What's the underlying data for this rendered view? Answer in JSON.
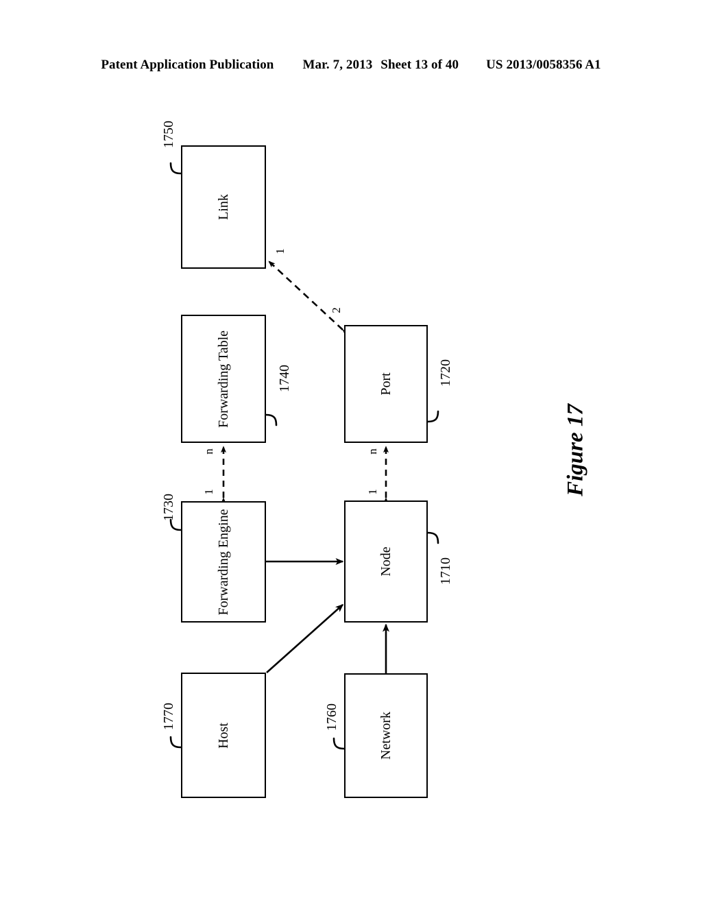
{
  "header": {
    "publication": "Patent Application Publication",
    "date": "Mar. 7, 2013",
    "sheet": "Sheet 13 of 40",
    "patent_number": "US 2013/0058356 A1"
  },
  "figure": {
    "caption": "Figure 17",
    "orientation": "landscape-rotated-90",
    "type": "uml-class-diagram"
  },
  "boxes": [
    {
      "id": "link",
      "label": "Link",
      "ref": "1750"
    },
    {
      "id": "forwarding_table",
      "label": "Forwarding Table",
      "ref": "1740"
    },
    {
      "id": "port",
      "label": "Port",
      "ref": "1720"
    },
    {
      "id": "forwarding_engine",
      "label": "Forwarding Engine",
      "ref": "1730"
    },
    {
      "id": "node",
      "label": "Node",
      "ref": "1710"
    },
    {
      "id": "host",
      "label": "Host",
      "ref": "1770"
    },
    {
      "id": "network",
      "label": "Network",
      "ref": "1760"
    }
  ],
  "multiplicities": {
    "link_end": "1",
    "port_end": "2",
    "forwarding_table_end": "n",
    "forwarding_engine_end": "1",
    "port_node_port_end": "n",
    "port_node_node_end": "1"
  },
  "connectors": [
    {
      "from": "port",
      "to": "link",
      "style": "dashed",
      "arrows": "both",
      "from_mult": "2",
      "to_mult": "1"
    },
    {
      "from": "forwarding_engine",
      "to": "forwarding_table",
      "style": "dashed",
      "arrows": "both",
      "from_mult": "1",
      "to_mult": "n"
    },
    {
      "from": "node",
      "to": "port",
      "style": "dashed",
      "arrows": "both",
      "from_mult": "1",
      "to_mult": "n"
    },
    {
      "from": "forwarding_engine",
      "to": "node",
      "style": "solid",
      "arrows": "end"
    },
    {
      "from": "host",
      "to": "node",
      "style": "solid",
      "arrows": "end"
    },
    {
      "from": "network",
      "to": "node",
      "style": "solid",
      "arrows": "end"
    }
  ],
  "colors": {
    "ink": "#000000",
    "page": "#ffffff"
  }
}
